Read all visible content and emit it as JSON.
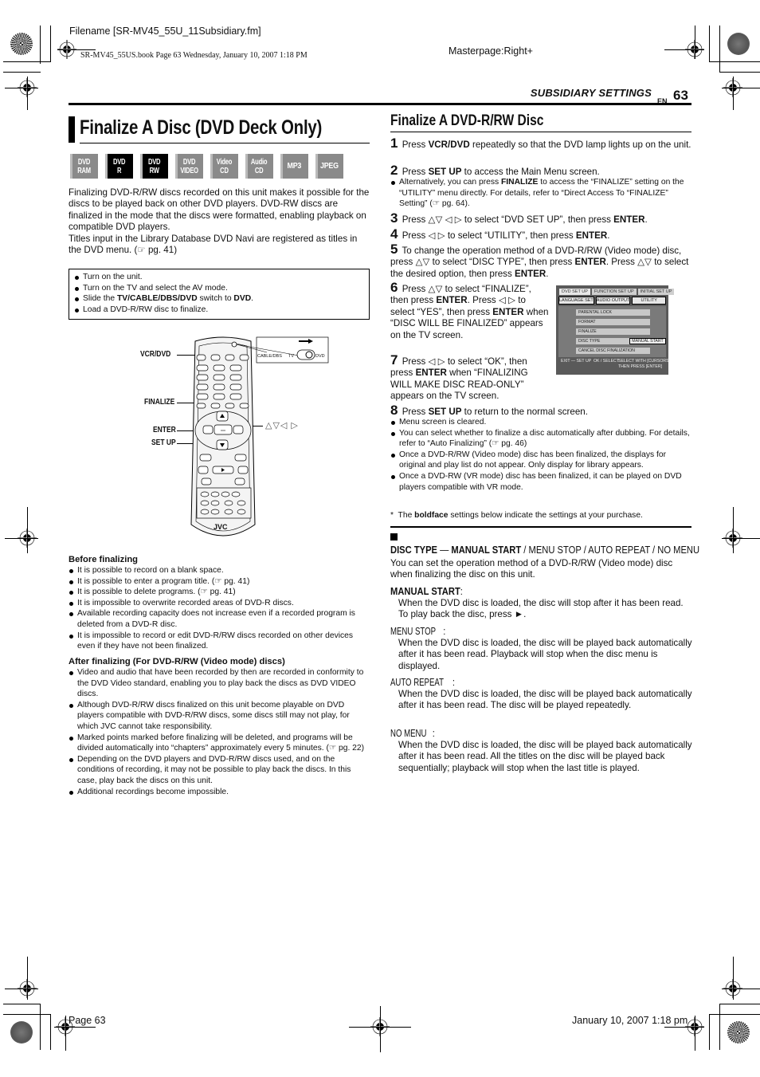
{
  "print_meta": {
    "filename": "Filename [SR-MV45_55U_11Subsidiary.fm]",
    "book_line": "SR-MV45_55US.book  Page 63  Wednesday, January 10, 2007  1:18 PM",
    "masterpage": "Masterpage:Right+",
    "footer_page": "Page 63",
    "footer_date": "January 10, 2007 1:18 pm"
  },
  "header": {
    "section": "SUBSIDIARY SETTINGS",
    "lang": "EN",
    "page_number": "63"
  },
  "left": {
    "title": "Finalize A Disc (DVD Deck Only)",
    "badges": [
      {
        "line1": "DVD",
        "line2": "RAM",
        "active": false
      },
      {
        "line1": "DVD",
        "line2": "R",
        "active": true
      },
      {
        "line1": "DVD",
        "line2": "RW",
        "active": true
      },
      {
        "line1": "DVD",
        "line2": "VIDEO",
        "active": false
      },
      {
        "line1": "Video",
        "line2": "CD",
        "active": false
      },
      {
        "line1": "Audio",
        "line2": "CD",
        "active": false
      },
      {
        "line1": "MP3",
        "line2": "",
        "active": false
      },
      {
        "line1": "JPEG",
        "line2": "",
        "active": false
      }
    ],
    "intro1": "Finalizing DVD-R/RW discs recorded on this unit makes it possible for the discs to be played back on other DVD players. DVD-RW discs are finalized in the mode that the discs were formatted, enabling playback on compatible DVD players.",
    "intro2": "Titles input in the Library Database DVD Navi are registered as titles in the DVD menu. (☞ pg. 41)",
    "prep": [
      "Turn on the unit.",
      "Turn on the TV and select the AV mode.",
      {
        "pre": "Slide the ",
        "bold1": "TV/CABLE/DBS/DVD",
        "mid": " switch to ",
        "bold2": "DVD",
        "post": "."
      },
      "Load a DVD-R/RW disc to finalize."
    ],
    "remote": {
      "callouts": [
        "VCR/DVD",
        "FINALIZE",
        "ENTER",
        "SET UP"
      ],
      "arrows": "△▽◁ ▷",
      "switch_labels": [
        "CABLE/DBS",
        "TV",
        "DVD"
      ],
      "brand": "JVC"
    },
    "before_title": "Before finalizing",
    "before": [
      "It is possible to record on a blank space.",
      "It is possible to enter a program title. (☞ pg. 41)",
      "It is possible to delete programs. (☞ pg. 41)",
      "It is impossible to overwrite recorded areas of DVD-R discs.",
      "Available recording capacity does not increase even if a recorded program is deleted from a DVD-R disc.",
      "It is impossible to record or edit DVD-R/RW discs recorded on other devices even if they have not been finalized."
    ],
    "after_title": "After finalizing (For DVD-R/RW (Video mode) discs)",
    "after": [
      "Video and audio that have been recorded by then are recorded in conformity to the DVD Video standard, enabling you to play back the discs as DVD VIDEO discs.",
      "Although DVD-R/RW discs finalized on this unit become playable on DVD players compatible with DVD-R/RW discs, some discs still may not play, for which JVC cannot take responsibility.",
      "Marked points marked before finalizing will be deleted, and programs will be divided automatically into “chapters” approximately every 5 minutes. (☞ pg. 22)",
      "Depending on the DVD players and DVD-R/RW discs used, and on the conditions of recording, it may not be possible to play back the discs. In this case, play back the discs on this unit.",
      "Additional recordings become impossible."
    ]
  },
  "right": {
    "title": "Finalize A DVD-R/RW Disc",
    "steps": [
      {
        "n": "1",
        "a": "Press ",
        "b": "VCR/DVD",
        "c": " repeatedly so that the DVD lamp lights up on the unit."
      },
      {
        "n": "2",
        "a": "Press ",
        "b": "SET UP",
        "c": " to access the Main Menu screen."
      },
      {
        "n": "3",
        "a": "Press △▽ ◁ ▷ to select “DVD SET UP”, then press ",
        "b": "ENTER",
        "c": "."
      },
      {
        "n": "4",
        "a": "Press ◁ ▷ to select “UTILITY”, then press ",
        "b": "ENTER",
        "c": "."
      },
      {
        "n": "5",
        "a": "To change the operation method of a DVD-R/RW (Video mode) disc, press △▽ to select “DISC TYPE”, then press ",
        "b": "ENTER",
        "c": ". Press △▽ to select the desired option, then press ",
        "d": "ENTER",
        "e": "."
      },
      {
        "n": "6",
        "a": "Press △▽ to select “FINALIZE”, then press ",
        "b": "ENTER",
        "c": ". Press ◁ ▷ to select “YES”, then press ",
        "d": "ENTER",
        "e": " when “DISC WILL BE FINALIZED” appears on the TV screen."
      },
      {
        "n": "7",
        "a": "Press ◁ ▷ to select “OK”, then press ",
        "b": "ENTER",
        "c": " when “FINALIZING WILL MAKE DISC READ-ONLY” appears on the TV screen."
      },
      {
        "n": "8",
        "a": "Press ",
        "b": "SET UP",
        "c": " to return to the normal screen."
      }
    ],
    "step2_note": {
      "a": "Alternatively, you can press ",
      "b": "FINALIZE",
      "c": " to access the “FINALIZE” setting on the “UTILITY” menu directly. For details, refer to “Direct Access To “FINALIZE” Setting” (☞ pg. 64)."
    },
    "step8_notes": [
      "Menu screen is cleared.",
      "You can select whether to finalize a disc automatically after dubbing. For details, refer to “Auto Finalizing” (☞ pg. 46)",
      "Once a DVD-R/RW (Video mode) disc has been finalized, the displays for original and play list do not appear. Only display for library appears.",
      "Once a DVD-RW (VR mode) disc has been finalized, it can be played on DVD players compatible with VR mode."
    ],
    "tv_screen": {
      "tabs": [
        "DVD SET UP",
        "FUNCTION SET UP",
        "INITIAL SET UP"
      ],
      "subtabs": [
        "LANGUAGE SET",
        "AUDIO OUTPUT",
        "UTILITY"
      ],
      "items": [
        "PARENTAL LOCK",
        "FORMAT",
        "FINALIZE",
        "DISC TYPE",
        "CANCEL DISC FINALIZATION"
      ],
      "disc_type_value": "MANUAL START",
      "footer_left": "EXIT — SET UP",
      "footer_mid": "OK / SELECT",
      "footer_right1": "SELECT WITH [CURSORS]",
      "footer_right2": "THEN PRESS [ENTER]"
    },
    "asterisk": {
      "a": "The ",
      "b": "boldface",
      "c": " settings below indicate the settings at your purchase."
    },
    "disc_type": {
      "label": "DISC TYPE",
      "dash": " — ",
      "default": "MANUAL START",
      "others": " / MENU STOP / AUTO REPEAT / NO MENU",
      "desc": "You can set the operation method of a DVD-R/RW (Video mode) disc when finalizing the disc on this unit.",
      "options": [
        {
          "name": "MANUAL START",
          "bold": true,
          "text": "When the DVD disc is loaded, the disc will stop after it has been read. To play back the disc, press ►."
        },
        {
          "name": "MENU STOP",
          "bold": false,
          "text": "When the DVD disc is loaded, the disc will be played back automatically after it has been read. Playback will stop when the disc menu is displayed."
        },
        {
          "name": "AUTO REPEAT",
          "bold": false,
          "text": "When the DVD disc is loaded, the disc will be played back automatically after it has been read. The disc will be played repeatedly."
        },
        {
          "name": "NO MENU",
          "bold": false,
          "text": "When the DVD disc is loaded, the disc will be played back automatically after it has been read. All the titles on the disc will be played back sequentially; playback will stop when the last title is played."
        }
      ]
    }
  }
}
